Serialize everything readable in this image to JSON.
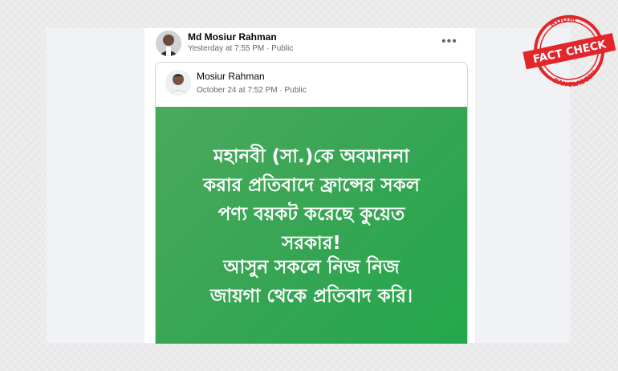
{
  "post": {
    "author": "Md Mosiur Rahman",
    "meta": "Yesterday at 7:55 PM · Public",
    "more_icon": "•••"
  },
  "shared_post": {
    "author": "Mosiur Rahman",
    "meta": "October 24 at 7:52 PM · Public"
  },
  "banner": {
    "lines_1": [
      "মহানবী (সা.)কে অবমাননা",
      "করার প্রতিবাদে ফ্রান্সের সকল",
      "পণ্য বয়কট করেছে কুয়েত",
      "সরকার!"
    ],
    "lines_2": [
      "আসুন সকলে নিজ নিজ",
      "জায়গা থেকে প্রতিবাদ করি।"
    ],
    "color": "#35a553"
  },
  "stamp": {
    "top": "BOOM",
    "middle": "FACT CHECK",
    "bottom": "BANGLADESH",
    "color": "#e3262a"
  }
}
